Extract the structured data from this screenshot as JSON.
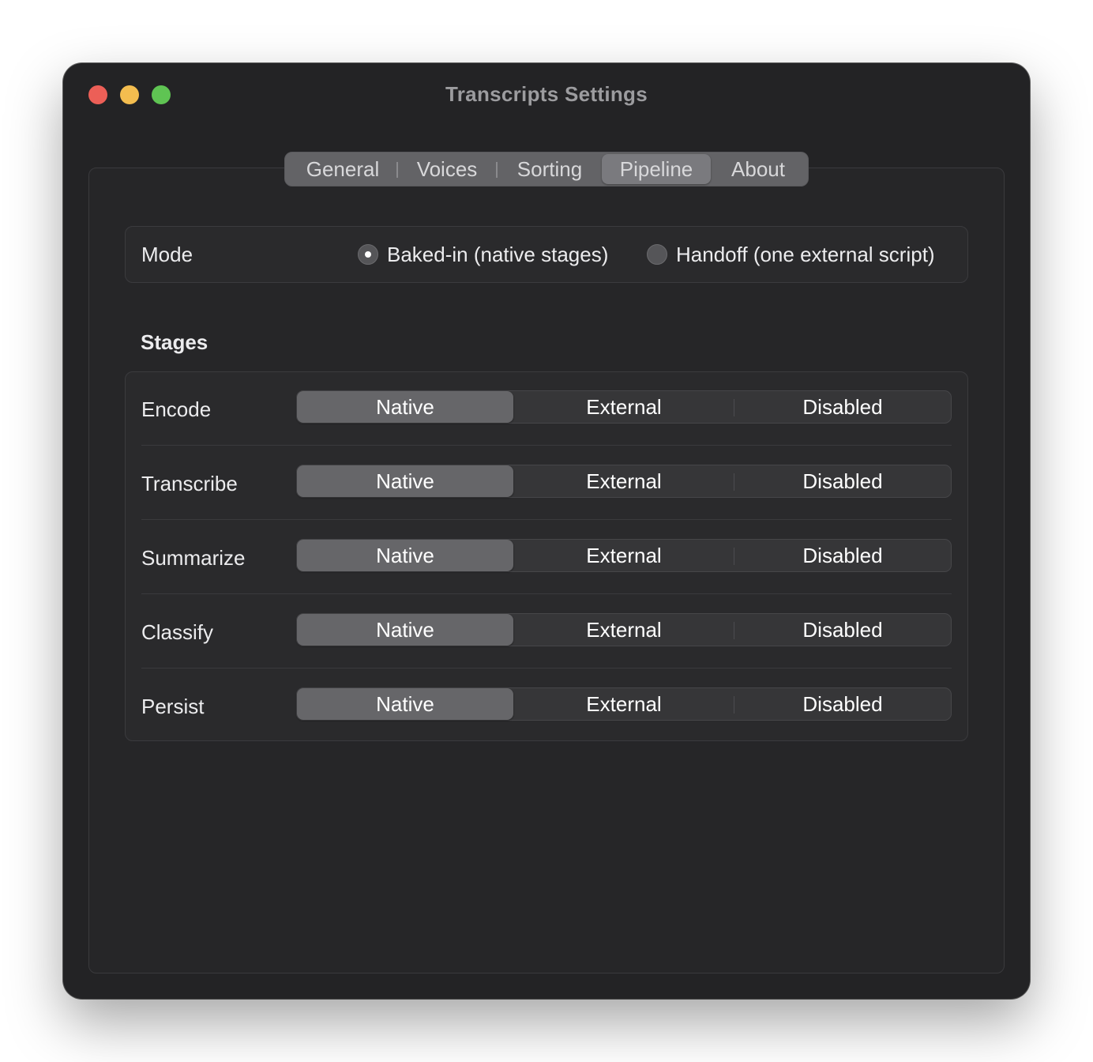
{
  "window": {
    "title": "Transcripts Settings"
  },
  "tabs": [
    {
      "label": "General"
    },
    {
      "label": "Voices"
    },
    {
      "label": "Sorting"
    },
    {
      "label": "Pipeline",
      "active": true
    },
    {
      "label": "About"
    }
  ],
  "mode": {
    "label": "Mode",
    "options": [
      {
        "label": "Baked-in (native stages)",
        "selected": true
      },
      {
        "label": "Handoff (one external script)",
        "selected": false
      }
    ]
  },
  "stages": {
    "title": "Stages",
    "options": [
      "Native",
      "External",
      "Disabled"
    ],
    "rows": [
      {
        "name": "Encode",
        "selected": "Native"
      },
      {
        "name": "Transcribe",
        "selected": "Native"
      },
      {
        "name": "Summarize",
        "selected": "Native"
      },
      {
        "name": "Classify",
        "selected": "Native"
      },
      {
        "name": "Persist",
        "selected": "Native"
      }
    ]
  },
  "colors": {
    "window_bg": "#232325",
    "close": "#ec5f57",
    "minimize": "#f3bd4f",
    "maximize": "#5fc453"
  }
}
